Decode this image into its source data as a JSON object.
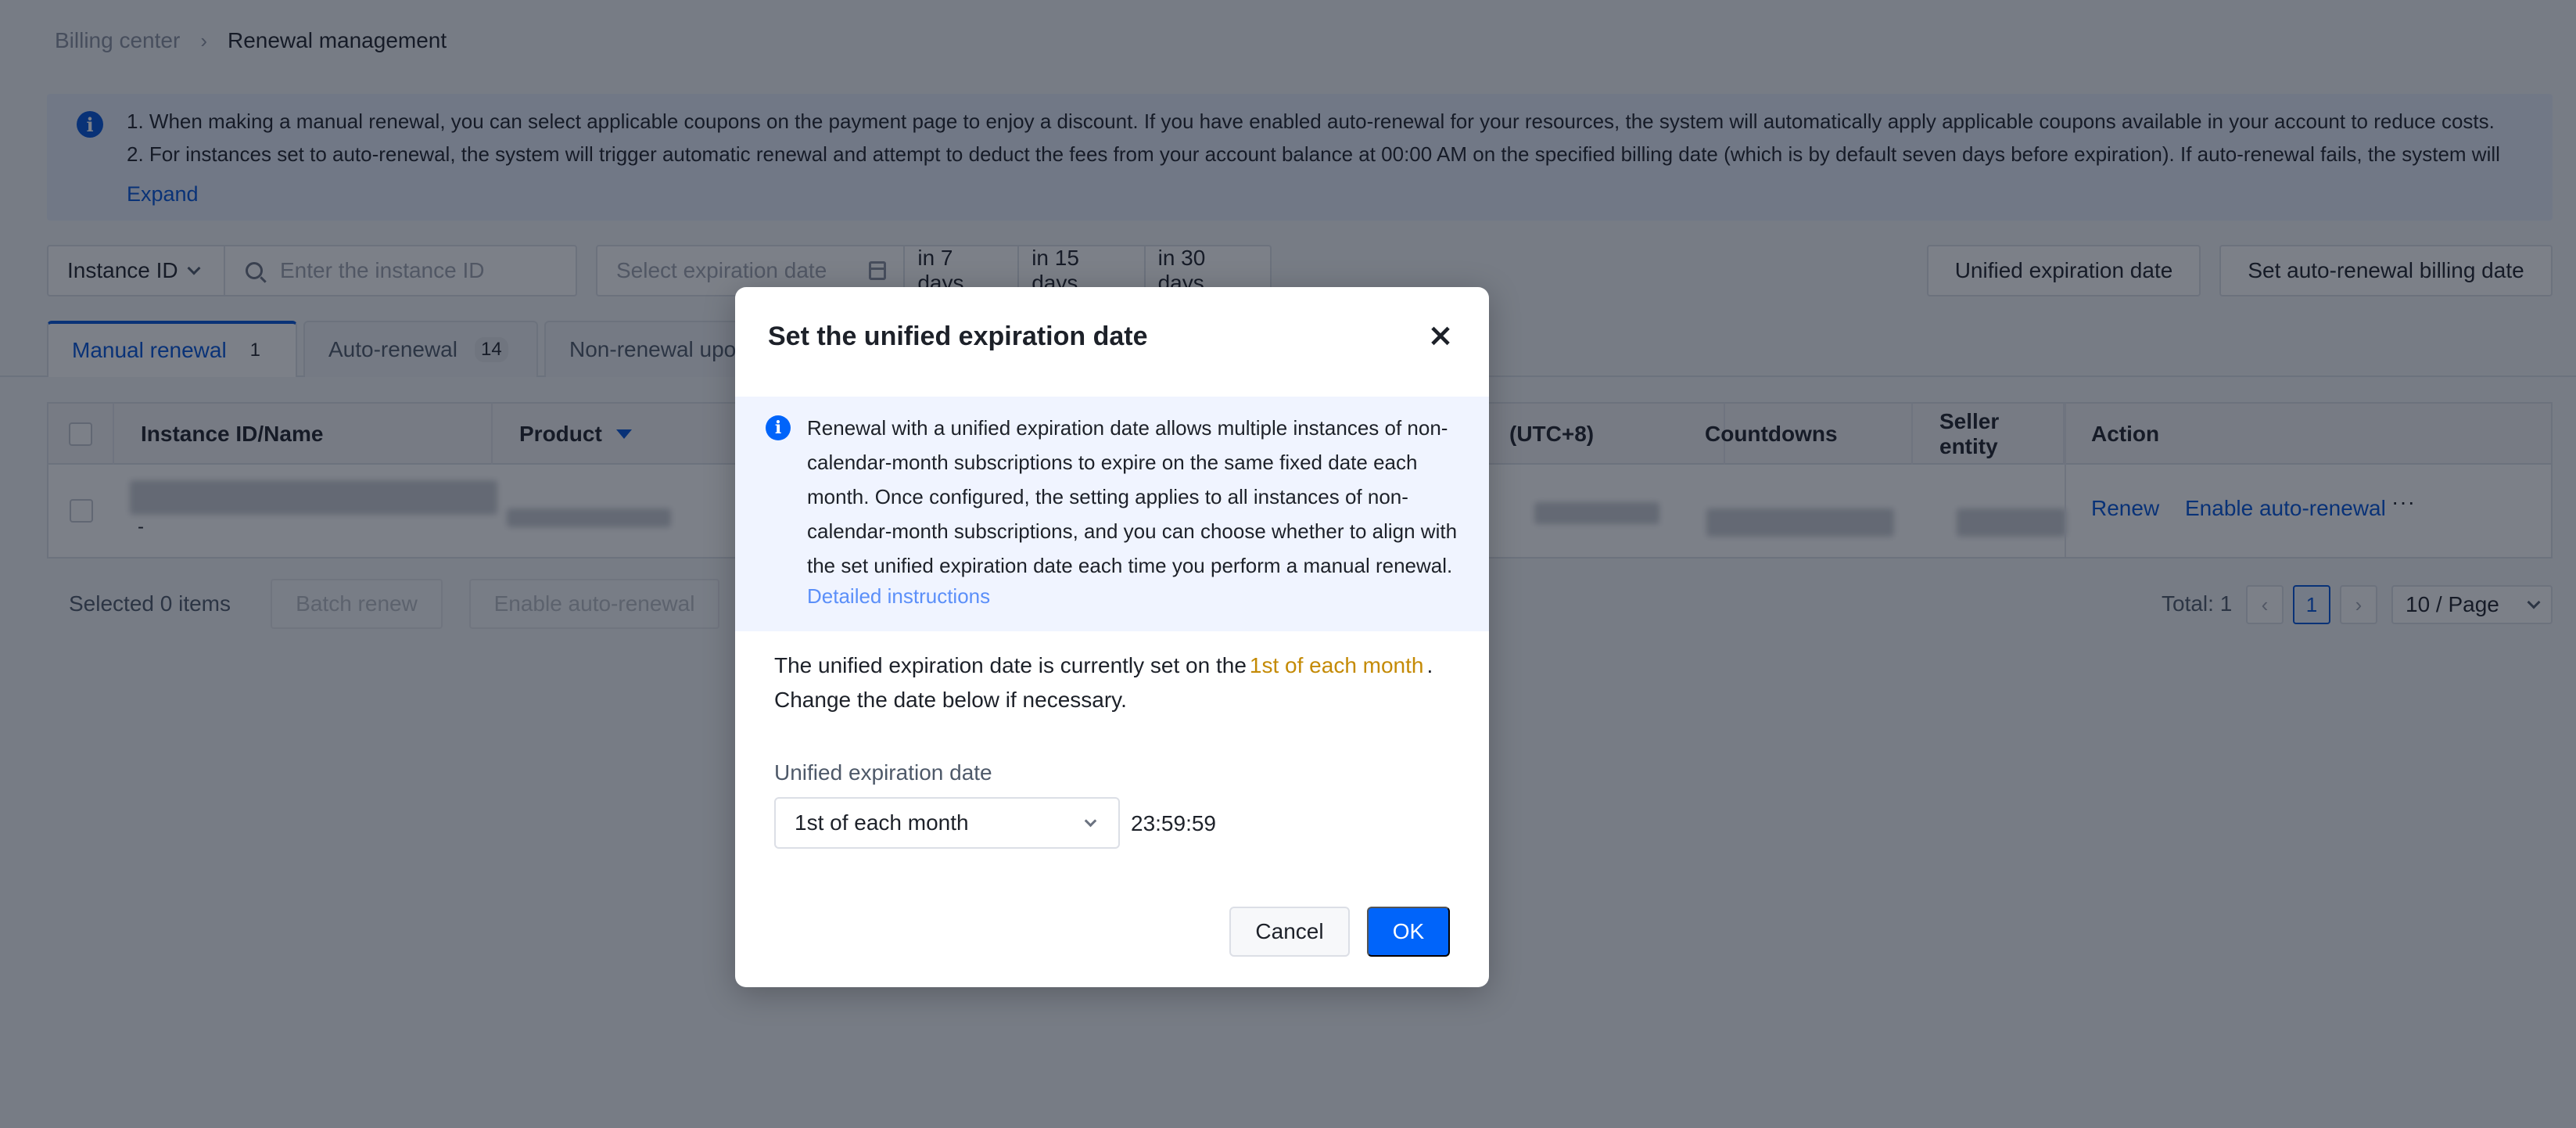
{
  "breadcrumb": {
    "parent": "Billing center",
    "separator": "›",
    "current": "Renewal management"
  },
  "notice": {
    "icon": "info-icon",
    "lines": [
      "1. When making a manual renewal, you can select applicable coupons on the payment page to enjoy a discount. If you have enabled auto-renewal for your resources, the system will automatically apply applicable coupons available in your account to reduce costs.",
      "2. For instances set to auto-renewal, the system will trigger automatic renewal and attempt to deduct the fees from your account balance at 00:00 AM on the specified billing date (which is by default seven days before expiration). If auto-renewal fails, the system will"
    ],
    "expand_label": "Expand"
  },
  "filters": {
    "search_field_select": "Instance ID",
    "search_placeholder": "Enter the instance ID",
    "date_placeholder": "Select expiration date",
    "quick_ranges": [
      "in 7 days",
      "in 15 days",
      "in 30 days"
    ]
  },
  "toolbar": {
    "unified_expiration_label": "Unified expiration date",
    "auto_renewal_billing_label": "Set auto-renewal billing date"
  },
  "tabs": [
    {
      "label": "Manual renewal",
      "count": "1",
      "active": true
    },
    {
      "label": "Auto-renewal",
      "count": "14",
      "active": false
    },
    {
      "label": "Non-renewal upo",
      "count": "",
      "active": false
    }
  ],
  "table": {
    "columns": [
      "Instance ID/Name",
      "Product",
      "(UTC+8)",
      "Countdowns",
      "Seller entity",
      "Action"
    ],
    "rows": [
      {
        "instance_name": "-",
        "actions": [
          "Renew",
          "Enable auto-renewal",
          "···"
        ]
      }
    ]
  },
  "footer": {
    "selected_text": "Selected 0 items",
    "batch_renew_label": "Batch renew",
    "enable_auto_renewal_label": "Enable auto-renewal",
    "total_text": "Total: 1",
    "prev": "‹",
    "current_page": "1",
    "next": "›",
    "page_size": "10  / Page"
  },
  "modal": {
    "title": "Set the unified expiration date",
    "close_glyph": "×",
    "info_text": "Renewal with a unified expiration date allows multiple instances of non-calendar-month subscriptions to expire on the same fixed date each month. Once configured, the setting applies to all instances of non-calendar-month subscriptions, and you can choose whether to align with the set unified expiration date each time you perform a manual renewal.",
    "info_link": "Detailed instructions",
    "status_prefix": "The unified expiration date is currently set on the",
    "status_highlight": "1st of each month",
    "status_suffix": ".",
    "status_line2": "Change the date below if necessary.",
    "field_label": "Unified expiration date",
    "field_value": "1st of each month",
    "field_time": "23:59:59",
    "cancel_label": "Cancel",
    "ok_label": "OK",
    "highlight_color": "#c48a05",
    "primary_color": "#0064fa"
  }
}
